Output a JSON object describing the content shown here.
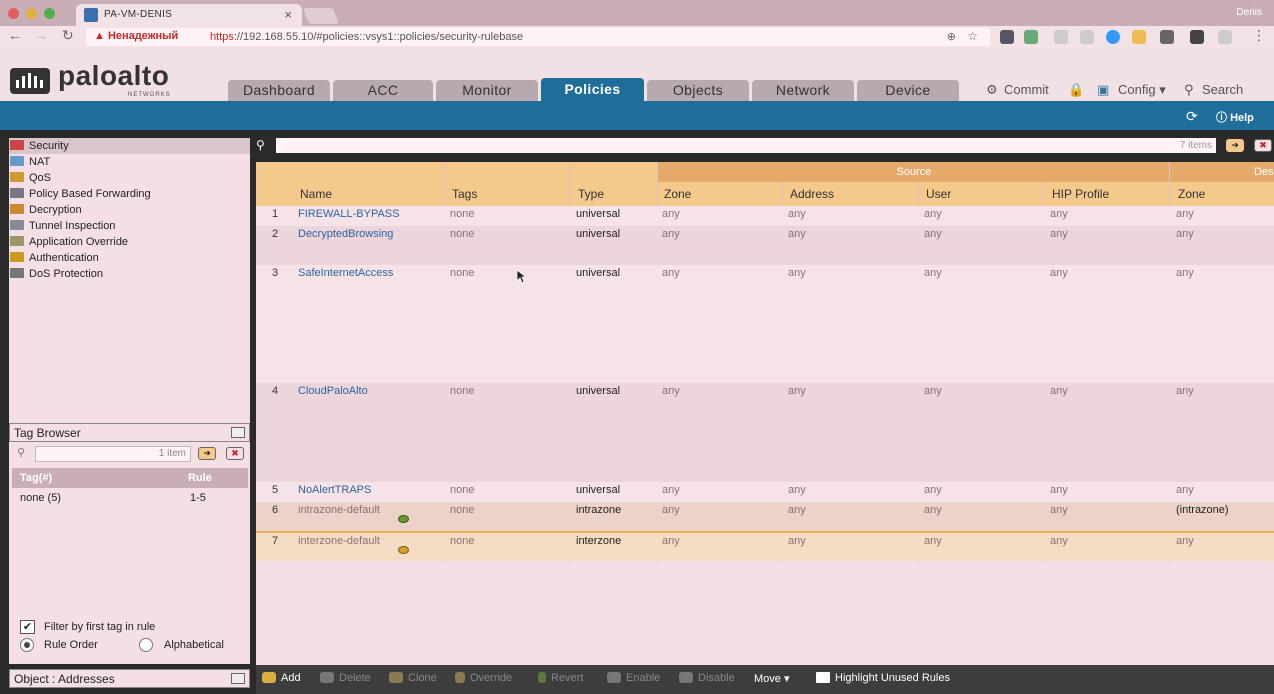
{
  "browser": {
    "tab_title": "PA-VM-DENIS",
    "tab_close": "×",
    "profile_name": "Denis",
    "security_warning": "▲ Ненадежный",
    "url_scheme": "https",
    "url_rest": "://192.168.55.10/#policies::vsys1::policies/security-rulebase",
    "zoom_icon": "⊕",
    "star_icon": "☆"
  },
  "brand": {
    "name": "paloalto",
    "sub": "NETWORKS"
  },
  "nav_tabs": [
    "Dashboard",
    "ACC",
    "Monitor",
    "Policies",
    "Objects",
    "Network",
    "Device"
  ],
  "header_links": {
    "commit": "Commit",
    "config": "Config ▾",
    "search": "Search",
    "help": "Help"
  },
  "policy_list": [
    "Security",
    "NAT",
    "QoS",
    "Policy Based Forwarding",
    "Decryption",
    "Tunnel Inspection",
    "Application Override",
    "Authentication",
    "DoS Protection"
  ],
  "tag_browser": {
    "title": "Tag Browser",
    "count": "1 item",
    "col_tag": "Tag(#)",
    "col_rule": "Rule",
    "rows": [
      {
        "tag": "none (5)",
        "rule": "1-5"
      }
    ],
    "filter_label": "Filter by first tag in rule",
    "rule_order": "Rule Order",
    "alphabetical": "Alphabetical"
  },
  "object_bar": "Object : Addresses",
  "grid": {
    "item_count": "7 items",
    "source_group": "Source",
    "dest_group": "Des",
    "columns": [
      "Name",
      "Tags",
      "Type",
      "Zone",
      "Address",
      "User",
      "HIP Profile",
      "Zone"
    ],
    "rows": [
      {
        "num": "1",
        "name": "FIREWALL-BYPASS",
        "tags": "none",
        "type": "universal",
        "szone": "any",
        "addr": "any",
        "user": "any",
        "hip": "any",
        "dzone": "any"
      },
      {
        "num": "2",
        "name": "DecryptedBrowsing",
        "tags": "none",
        "type": "universal",
        "szone": "any",
        "addr": "any",
        "user": "any",
        "hip": "any",
        "dzone": "any"
      },
      {
        "num": "3",
        "name": "SafeInternetAccess",
        "tags": "none",
        "type": "universal",
        "szone": "any",
        "addr": "any",
        "user": "any",
        "hip": "any",
        "dzone": "any"
      },
      {
        "num": "4",
        "name": "CloudPaloAlto",
        "tags": "none",
        "type": "universal",
        "szone": "any",
        "addr": "any",
        "user": "any",
        "hip": "any",
        "dzone": "any"
      },
      {
        "num": "5",
        "name": "NoAlertTRAPS",
        "tags": "none",
        "type": "universal",
        "szone": "any",
        "addr": "any",
        "user": "any",
        "hip": "any",
        "dzone": "any"
      },
      {
        "num": "6",
        "name": "intrazone-default",
        "tags": "none",
        "type": "intrazone",
        "szone": "any",
        "addr": "any",
        "user": "any",
        "hip": "any",
        "dzone": "(intrazone)"
      },
      {
        "num": "7",
        "name": "interzone-default",
        "tags": "none",
        "type": "interzone",
        "szone": "any",
        "addr": "any",
        "user": "any",
        "hip": "any",
        "dzone": "any"
      }
    ]
  },
  "toolbar": {
    "add": "Add",
    "delete": "Delete",
    "clone": "Clone",
    "override": "Override",
    "revert": "Revert",
    "enable": "Enable",
    "disable": "Disable",
    "move": "Move ▾",
    "highlight": "Highlight Unused Rules"
  },
  "colors": {
    "brand_blue": "#1f6e9a",
    "header_orange": "#f5c98c",
    "group_orange": "#e5a96a",
    "link_blue": "#2c64a0"
  }
}
